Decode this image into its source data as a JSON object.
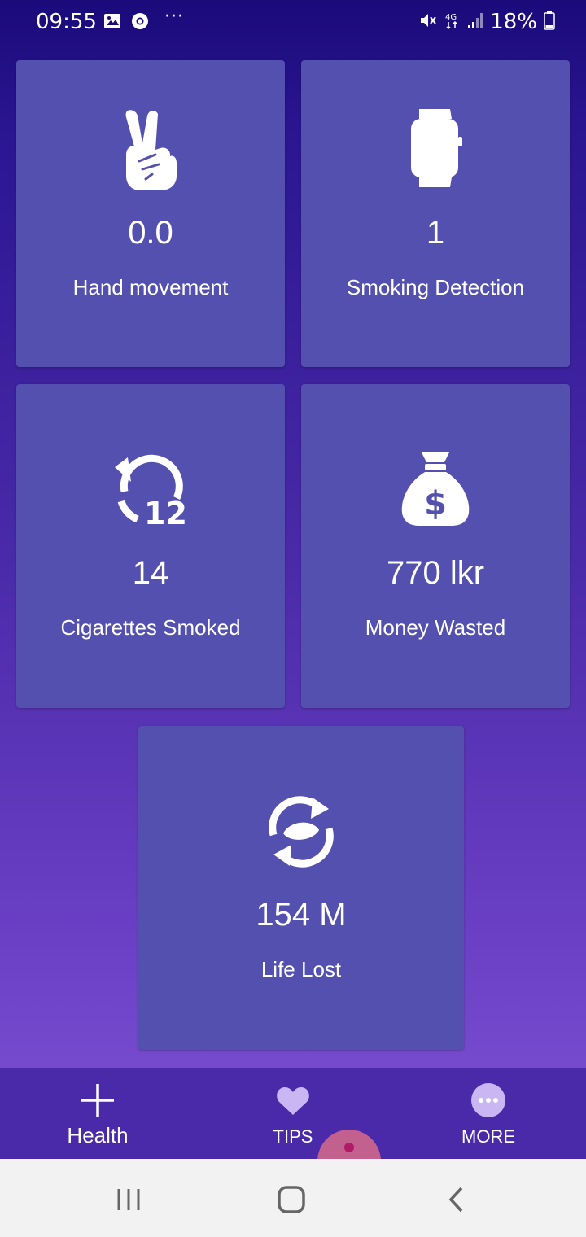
{
  "status_bar": {
    "time": "09:55",
    "dots": "···",
    "battery": "18%",
    "icons": [
      "gallery-icon",
      "chrome-icon",
      "mute-icon",
      "4g-icon",
      "signal-icon",
      "battery-icon"
    ]
  },
  "cards": [
    {
      "icon": "victory-hand-icon",
      "value": "0.0",
      "label": "Hand movement"
    },
    {
      "icon": "smartwatch-icon",
      "value": "1",
      "label": "Smoking Detection"
    },
    {
      "icon": "counter-12-icon",
      "value": "14",
      "label": "Cigarettes Smoked",
      "icon_text": "12"
    },
    {
      "icon": "money-bag-icon",
      "value": "770 lkr",
      "label": "Money Wasted"
    },
    {
      "icon": "life-cycle-icon",
      "value": "154 M",
      "label": "Life Lost"
    }
  ],
  "bottom_nav": {
    "items": [
      {
        "icon": "plus-icon",
        "label": "Health"
      },
      {
        "icon": "heart-icon",
        "label": "TIPS"
      },
      {
        "icon": "more-icon",
        "label": "MORE"
      }
    ]
  },
  "colors": {
    "card": "#5350b0",
    "nav": "#4a2aa8",
    "accent_light": "#c9b6f2"
  }
}
